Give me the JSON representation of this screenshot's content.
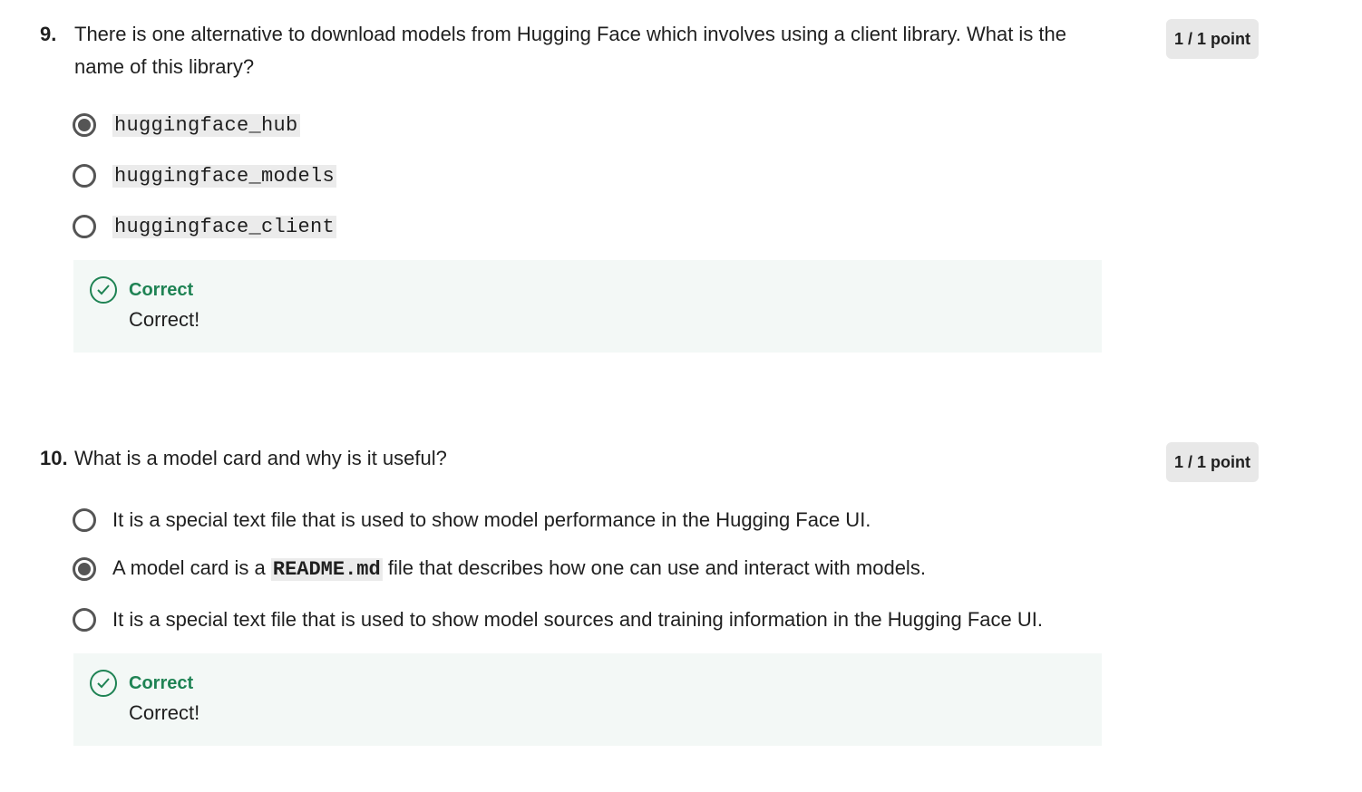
{
  "questions": [
    {
      "number": "9.",
      "text": "There is one alternative to download models from Hugging Face which involves using a client library. What is the name of this library?",
      "points": "1 / 1 point",
      "options": [
        {
          "label": "huggingface_hub",
          "selected": true
        },
        {
          "label": "huggingface_models",
          "selected": false
        },
        {
          "label": "huggingface_client",
          "selected": false
        }
      ],
      "feedback": {
        "title": "Correct",
        "text": "Correct!"
      }
    },
    {
      "number": "10.",
      "text": "What is a model card and why is it useful?",
      "points": "1 / 1 point",
      "options": [
        {
          "label": "It is a special text file that is used to show model performance in the Hugging Face UI.",
          "selected": false
        },
        {
          "label_prefix": "A model card is a",
          "label_code": "README.md",
          "label_suffix": "file that describes how one can use and interact with models.",
          "selected": true
        },
        {
          "label": "It is a special text file that is used to show model sources and training information in the Hugging Face UI.",
          "selected": false
        }
      ],
      "feedback": {
        "title": "Correct",
        "text": "Correct!"
      }
    }
  ],
  "colors": {
    "correct_green": "#1f8354",
    "feedback_bg": "#f3f8f6",
    "badge_bg": "#e8e8e8",
    "radio_gray": "#555555"
  },
  "icons": {
    "selected_radio": "radio-selected-icon",
    "unselected_radio": "radio-unselected-icon",
    "feedback": "check-circle-icon"
  }
}
